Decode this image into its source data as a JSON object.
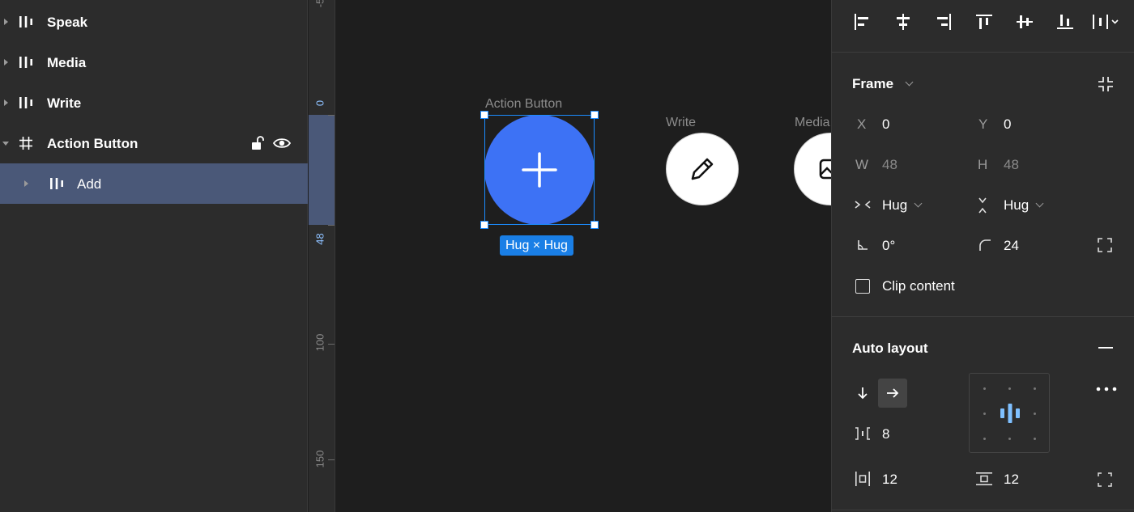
{
  "layers": [
    {
      "name": "Speak",
      "type": "component"
    },
    {
      "name": "Media",
      "type": "component"
    },
    {
      "name": "Write",
      "type": "component"
    },
    {
      "name": "Action Button",
      "type": "frame",
      "expanded": true
    },
    {
      "name": "Add",
      "type": "component",
      "selected": true
    }
  ],
  "ruler": {
    "labels": [
      "-5",
      "0",
      "48",
      "100",
      "150"
    ]
  },
  "canvas": {
    "frames": [
      {
        "title": "Action Button"
      },
      {
        "title": "Write"
      },
      {
        "title": "Media"
      }
    ],
    "size_badge": "Hug × Hug"
  },
  "design": {
    "frame": {
      "title": "Frame",
      "x_label": "X",
      "x_value": "0",
      "y_label": "Y",
      "y_value": "0",
      "w_label": "W",
      "w_value": "48",
      "h_label": "H",
      "h_value": "48",
      "width_mode": "Hug",
      "height_mode": "Hug",
      "rotation": "0°",
      "radius": "24",
      "clip_content_label": "Clip content"
    },
    "auto_layout": {
      "title": "Auto layout",
      "gap": "8",
      "padding_horizontal": "12",
      "padding_vertical": "12"
    }
  },
  "colors": {
    "accent": "#3d72f5",
    "selection": "#1b8cff",
    "layer_selected": "#4a5878"
  }
}
